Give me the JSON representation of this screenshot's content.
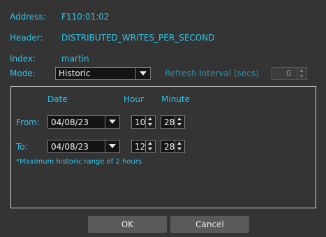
{
  "info": {
    "address_label": "Address:",
    "address_value": "F110:01:02",
    "header_label": "Header:",
    "header_value": "DISTRIBUTED_WRITES_PER_SECOND",
    "index_label": "Index:",
    "index_value": "martin"
  },
  "mode": {
    "label": "Mode:",
    "selected": "Historic",
    "refresh_label": "Refresh Interval (secs)",
    "refresh_value": "0"
  },
  "range": {
    "date_header": "Date",
    "hour_header": "Hour",
    "minute_header": "Minute",
    "from": {
      "label": "From:",
      "date": "04/08/23",
      "hour": "10",
      "minute": "28"
    },
    "to": {
      "label": "To:",
      "date": "04/08/23",
      "hour": "12",
      "minute": "28"
    },
    "note": "*Maximum historic range of 2 hours"
  },
  "buttons": {
    "ok": "OK",
    "cancel": "Cancel"
  },
  "colors": {
    "background": "#343434",
    "accent": "#2ec4e8",
    "field": "#141414",
    "button": "#5a5a5a"
  }
}
